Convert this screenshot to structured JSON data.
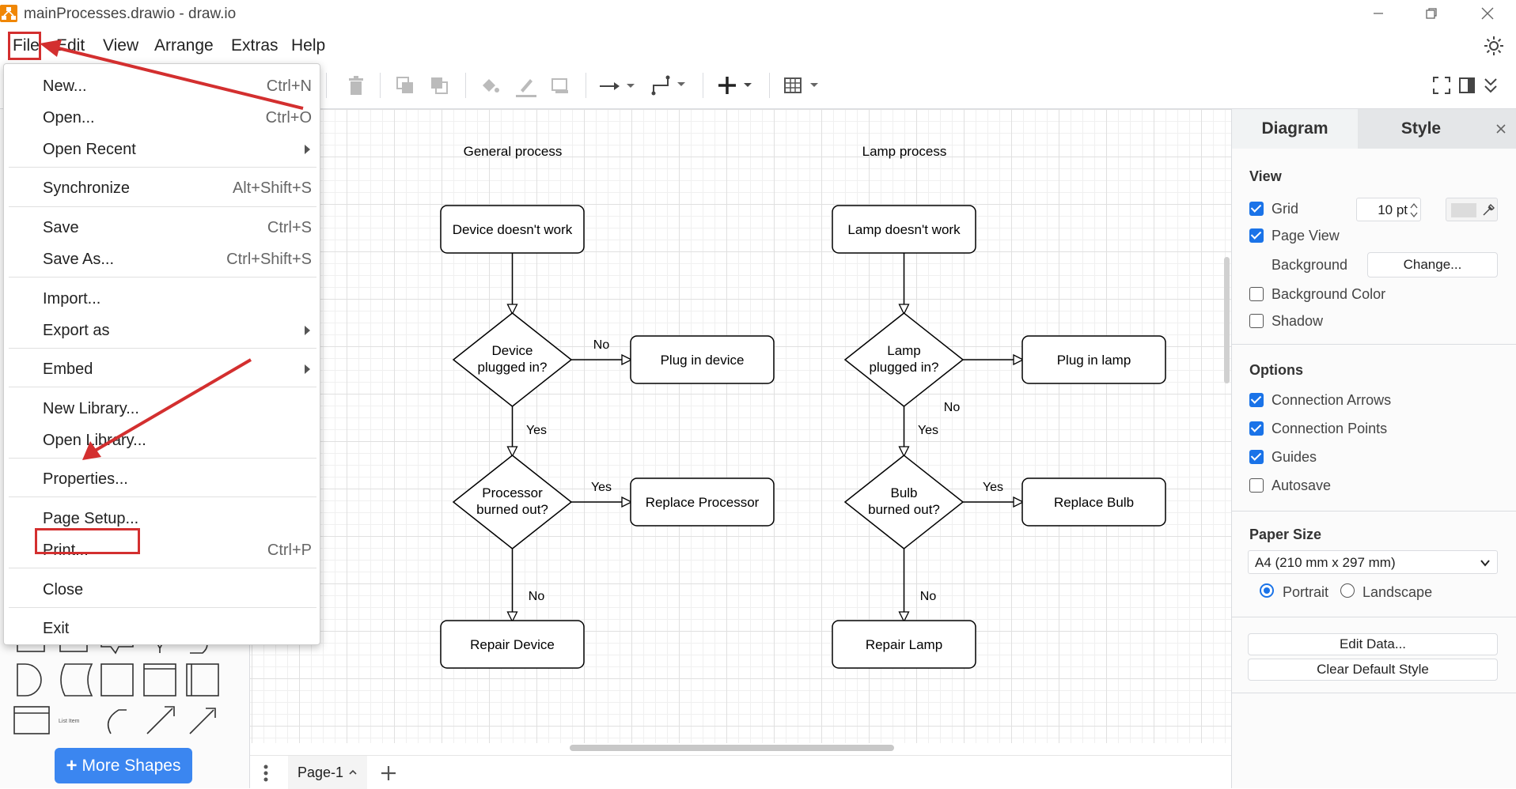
{
  "window": {
    "title": "mainProcesses.drawio - draw.io",
    "controls": [
      "minimize",
      "restore",
      "close"
    ]
  },
  "menubar": {
    "items": [
      "File",
      "Edit",
      "View",
      "Arrange",
      "Extras",
      "Help"
    ]
  },
  "file_menu": {
    "items": [
      {
        "label": "New...",
        "shortcut": "Ctrl+N"
      },
      {
        "label": "Open...",
        "shortcut": "Ctrl+O"
      },
      {
        "label": "Open Recent",
        "submenu": true
      },
      {
        "label": "Synchronize",
        "shortcut": "Alt+Shift+S"
      },
      {
        "label": "Save",
        "shortcut": "Ctrl+S"
      },
      {
        "label": "Save As...",
        "shortcut": "Ctrl+Shift+S"
      },
      {
        "label": "Import..."
      },
      {
        "label": "Export as",
        "submenu": true
      },
      {
        "label": "Embed",
        "submenu": true
      },
      {
        "label": "New Library..."
      },
      {
        "label": "Open Library..."
      },
      {
        "label": "Properties..."
      },
      {
        "label": "Page Setup..."
      },
      {
        "label": "Print...",
        "shortcut": "Ctrl+P"
      },
      {
        "label": "Close"
      },
      {
        "label": "Exit"
      }
    ]
  },
  "sidebar": {
    "more_shapes_label": "More Shapes",
    "list_item_label": "List Item"
  },
  "diagram": {
    "general": {
      "title": "General process",
      "start": "Device doesn't work",
      "decision1": [
        "Device",
        "plugged in?"
      ],
      "action1": "Plug in device",
      "decision2": [
        "Processor",
        "burned out?"
      ],
      "action2": "Replace Processor",
      "end": "Repair Device",
      "labels": {
        "no1": "No",
        "yes1": "Yes",
        "yes2": "Yes",
        "no2": "No"
      }
    },
    "lamp": {
      "title": "Lamp process",
      "start": "Lamp doesn't work",
      "decision1": [
        "Lamp",
        "plugged in?"
      ],
      "action1": "Plug in lamp",
      "decision2": [
        "Bulb",
        "burned out?"
      ],
      "action2": "Replace Bulb",
      "end": "Repair Lamp",
      "labels": {
        "no1": "No",
        "yes1": "Yes",
        "yes2": "Yes",
        "no2": "No"
      }
    }
  },
  "pages": {
    "current": "Page-1"
  },
  "format_panel": {
    "tabs": [
      "Diagram",
      "Style"
    ],
    "view_heading": "View",
    "grid_label": "Grid",
    "grid_checked": true,
    "grid_size": "10 pt",
    "page_view_label": "Page View",
    "page_view_checked": true,
    "background_label": "Background",
    "change_button": "Change...",
    "background_color_label": "Background Color",
    "background_color_checked": false,
    "shadow_label": "Shadow",
    "shadow_checked": false,
    "options_heading": "Options",
    "connection_arrows_label": "Connection Arrows",
    "connection_arrows_checked": true,
    "connection_points_label": "Connection Points",
    "connection_points_checked": true,
    "guides_label": "Guides",
    "guides_checked": true,
    "autosave_label": "Autosave",
    "autosave_checked": false,
    "paper_size_heading": "Paper Size",
    "paper_size_value": "A4 (210 mm x 297 mm)",
    "orientation": [
      "Portrait",
      "Landscape"
    ],
    "orientation_selected": "Portrait",
    "edit_data_button": "Edit Data...",
    "clear_style_button": "Clear Default Style"
  },
  "colors": {
    "accent": "#1a73e8",
    "annotation_red": "#d32f2f",
    "more_shapes_blue": "#3b86f0"
  }
}
